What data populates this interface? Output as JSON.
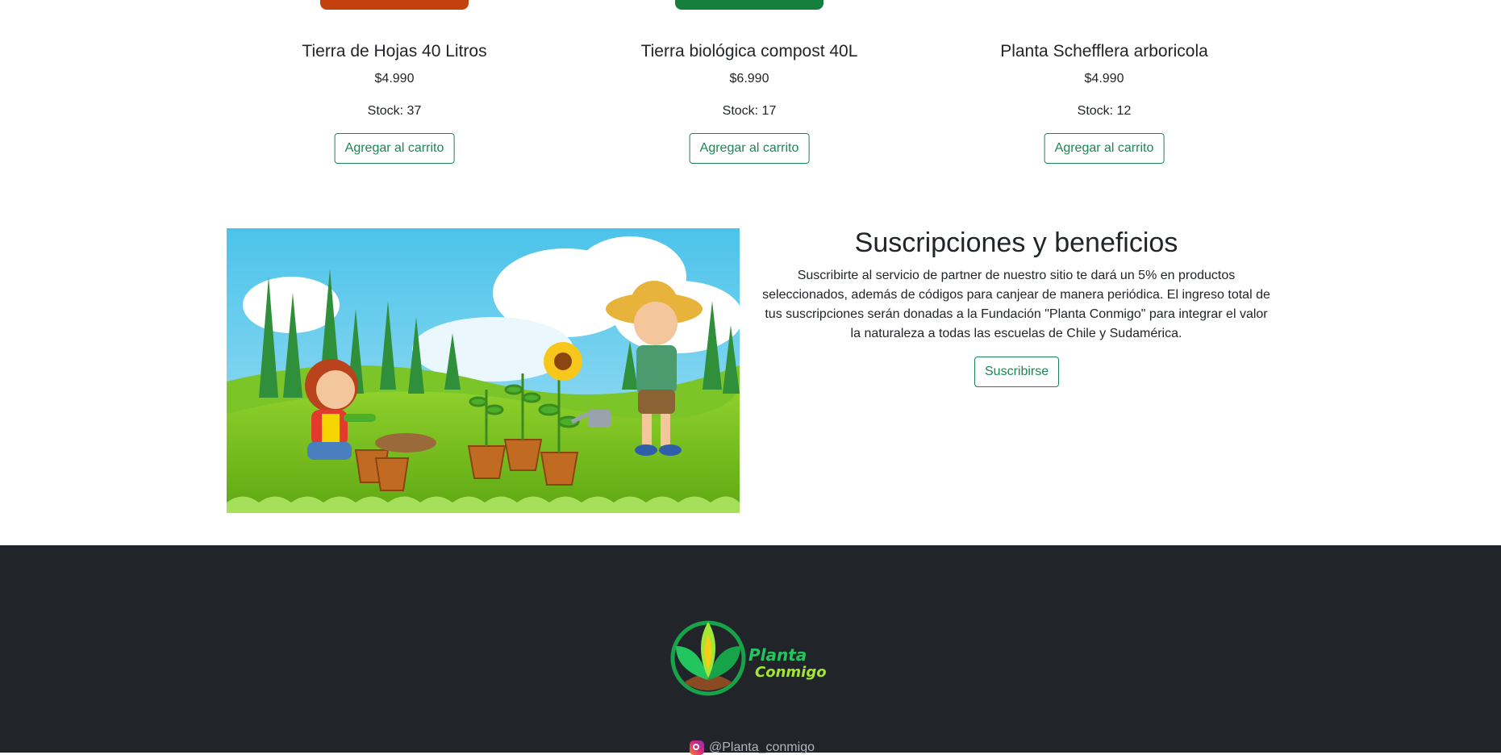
{
  "products": [
    {
      "name": "Tierra de Hojas 40 Litros",
      "price": "$4.990",
      "stock": "Stock: 37",
      "button": "Agregar al carrito",
      "color": "#c2410c"
    },
    {
      "name": "Tierra biológica compost 40L",
      "price": "$6.990",
      "stock": "Stock: 17",
      "button": "Agregar al carrito",
      "color": "#15803d"
    },
    {
      "name": "Planta Schefflera arboricola",
      "price": "$4.990",
      "stock": "Stock: 12",
      "button": "Agregar al carrito",
      "color": ""
    }
  ],
  "subscription": {
    "title": "Suscripciones y beneficios",
    "text": "Suscribirte al servicio de partner de nuestro sitio te dará un 5% en productos seleccionados, además de códigos para canjear de manera periódica. El ingreso total de tus suscripciones serán donadas a la Fundación \"Planta Conmigo\" para integrar el valor la naturaleza a todas las escuelas de Chile y Sudamérica.",
    "button": "Suscribirse"
  },
  "footer": {
    "logo_line1": "Planta",
    "logo_line2": "Conmigo",
    "instagram": "@Planta_conmigo",
    "background": "#212529"
  },
  "colors": {
    "accent": "#198754",
    "logo_green": "#22c55e",
    "logo_yellow": "#facc15"
  }
}
